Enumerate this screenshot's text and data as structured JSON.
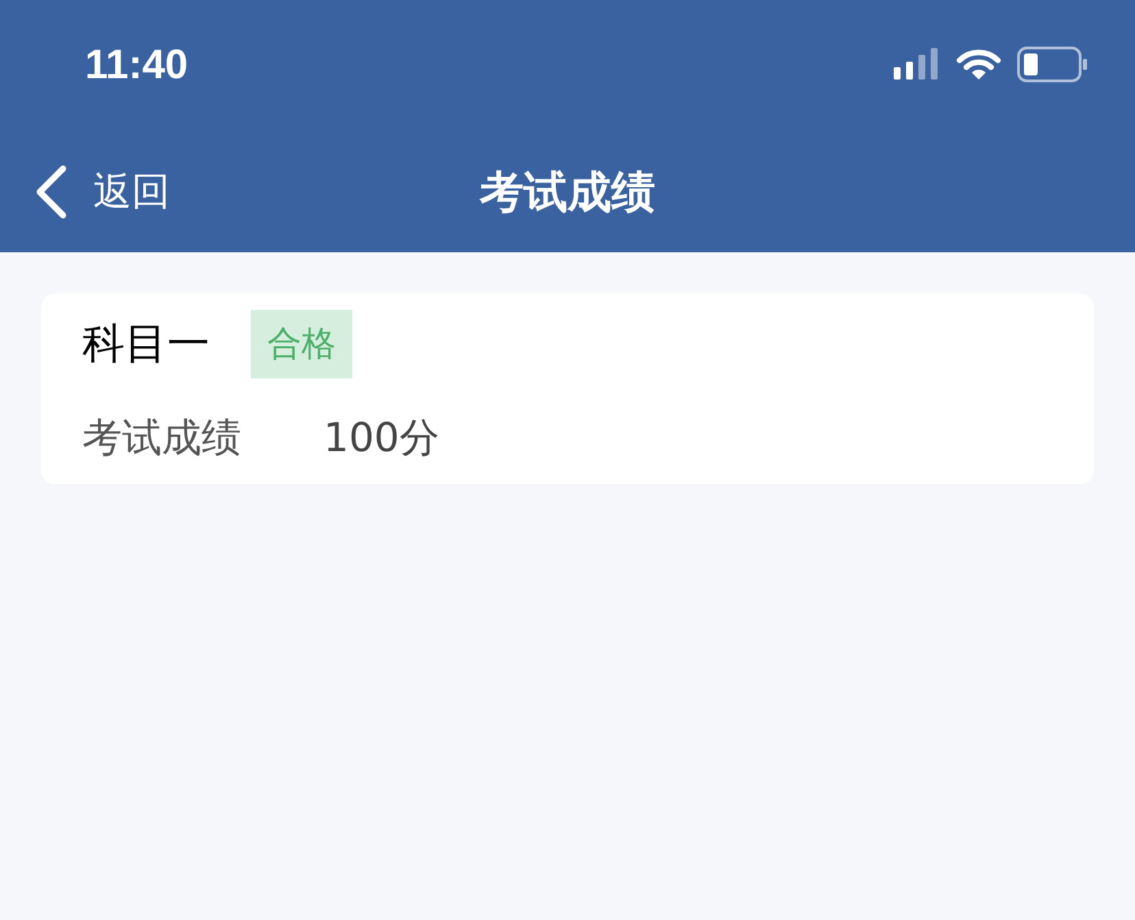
{
  "status_bar": {
    "time": "11:40"
  },
  "nav": {
    "back_label": "返回",
    "title": "考试成绩"
  },
  "results": [
    {
      "subject": "科目一",
      "badge": "合格",
      "score_label": "考试成绩",
      "score": "100分"
    }
  ]
}
